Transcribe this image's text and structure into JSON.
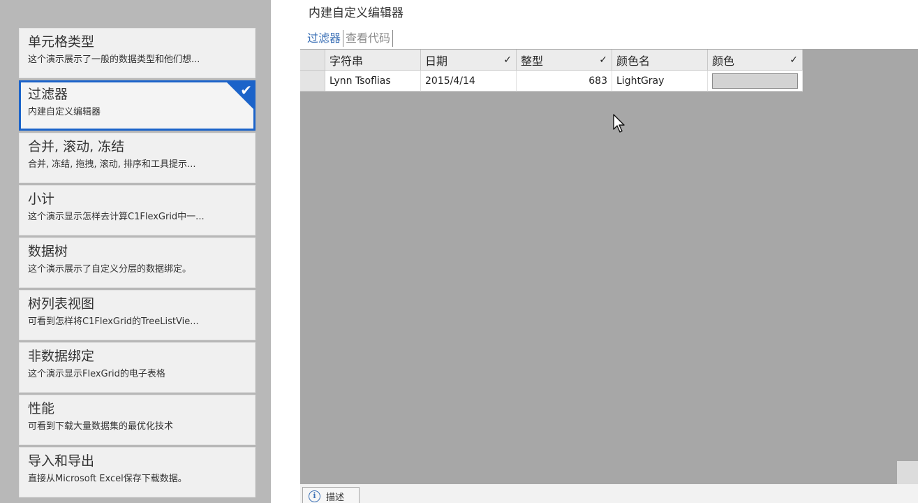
{
  "sidebar": {
    "items": [
      {
        "title": "单元格类型",
        "desc": "这个演示展示了一般的数据类型和他们想...",
        "selected": false
      },
      {
        "title": "过滤器",
        "desc": "内建自定义编辑器",
        "selected": true
      },
      {
        "title": "合并, 滚动, 冻结",
        "desc": "合并, 冻结, 拖拽, 滚动, 排序和工具提示...",
        "selected": false
      },
      {
        "title": "小计",
        "desc": "这个演示显示怎样去计算C1FlexGrid中一...",
        "selected": false
      },
      {
        "title": "数据树",
        "desc": "这个演示展示了自定义分层的数据绑定。",
        "selected": false
      },
      {
        "title": "树列表视图",
        "desc": "可看到怎样将C1FlexGrid的TreeListVie...",
        "selected": false
      },
      {
        "title": "非数据绑定",
        "desc": "这个演示显示FlexGrid的电子表格",
        "selected": false
      },
      {
        "title": "性能",
        "desc": "可看到下载大量数据集的最优化技术",
        "selected": false
      },
      {
        "title": "导入和导出",
        "desc": "直接从Microsoft Excel保存下载数据。",
        "selected": false
      }
    ]
  },
  "main": {
    "title": "内建自定义编辑器",
    "tabs": [
      {
        "label": "过滤器",
        "active": true
      },
      {
        "label": "查看代码",
        "active": false
      }
    ]
  },
  "grid": {
    "headers": [
      {
        "label": "字符串",
        "filter": false
      },
      {
        "label": "日期",
        "filter": true
      },
      {
        "label": "整型",
        "filter": true
      },
      {
        "label": "颜色名",
        "filter": false
      },
      {
        "label": "颜色",
        "filter": true
      }
    ],
    "filter_mark": "✓",
    "rows": [
      {
        "string": "Lynn Tsoflias",
        "date": "2015/4/14",
        "int": "683",
        "color_name": "LightGray",
        "color": "#d3d3d3"
      }
    ]
  },
  "bottom": {
    "desc_label": "描述",
    "info_glyph": "i"
  },
  "colors": {
    "accent": "#1b63c9",
    "sidebar_bg": "#b8b8b8",
    "grid_bg": "#a7a7a7"
  }
}
